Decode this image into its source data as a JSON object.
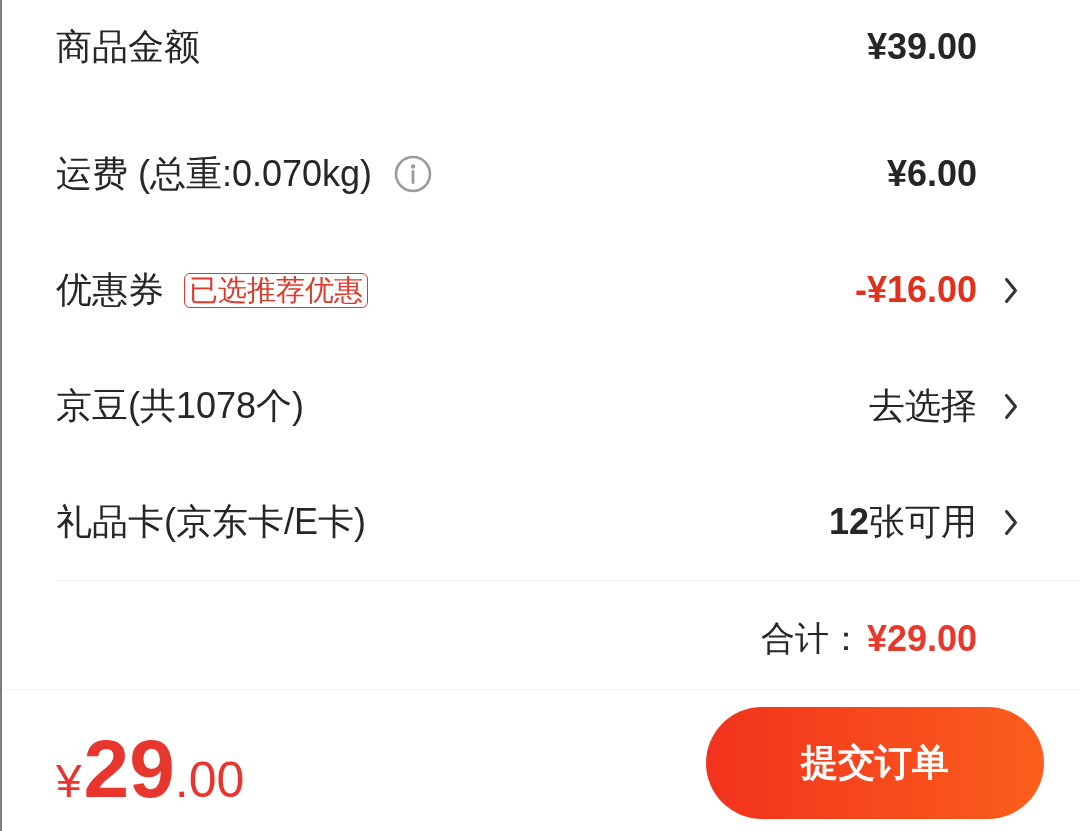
{
  "rows": [
    {
      "kind": "amount",
      "label": "商品金额",
      "value": "¥39.00",
      "info": false,
      "link": false,
      "highlighted": false
    },
    {
      "kind": "amount",
      "label": "运费 (总重:0.070kg)",
      "value": "¥6.00",
      "info": true,
      "link": false,
      "highlighted": false
    },
    {
      "kind": "amount",
      "label": "优惠券",
      "tag": "已选推荐优惠",
      "value": "-¥16.00",
      "info": false,
      "link": true,
      "highlighted": true
    },
    {
      "kind": "option",
      "label": "京豆(共1078个)",
      "value": "去选择",
      "info": false,
      "link": true,
      "highlighted": false
    },
    {
      "kind": "option",
      "label": "礼品卡(京东卡/E卡)",
      "value": "**12**张可用",
      "info": false,
      "link": true,
      "highlighted": false
    }
  ],
  "total": {
    "label": "合计：",
    "value": "¥29.00"
  },
  "pay_bar": {
    "currency": "¥",
    "integer": "29",
    "decimal": ".00",
    "submit_button": "提交订单"
  }
}
